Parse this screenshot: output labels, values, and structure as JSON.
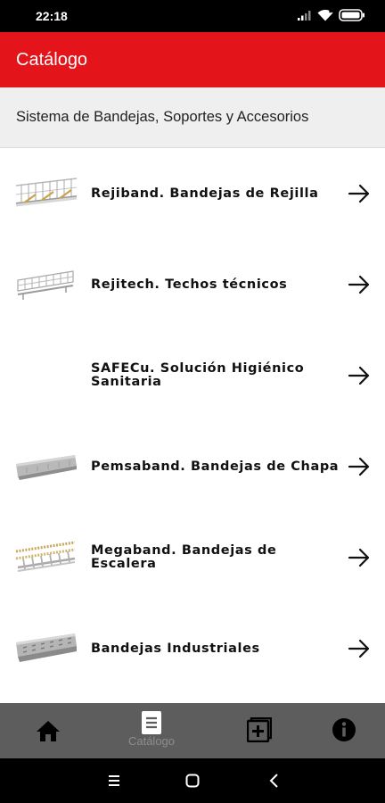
{
  "status_bar": {
    "time": "22:18",
    "icons": [
      "signal-icon",
      "wifi-icon",
      "battery-icon"
    ]
  },
  "app_bar": {
    "title": "Catálogo"
  },
  "section": {
    "title": "Sistema de Bandejas, Soportes y Accesorios"
  },
  "catalog": {
    "items": [
      {
        "label": "Rejiband. Bandejas de Rejilla",
        "thumb": "wire-mesh-tray-image"
      },
      {
        "label": "Rejitech. Techos técnicos",
        "thumb": "technical-ceiling-image"
      },
      {
        "label": "SAFECu. Solución Higiénico\nSanitaria",
        "thumb": ""
      },
      {
        "label": "Pemsaband. Bandejas de Chapa",
        "thumb": "sheet-metal-tray-image"
      },
      {
        "label": "Megaband. Bandejas de\nEscalera",
        "thumb": "ladder-tray-image"
      },
      {
        "label": "Bandejas Industriales",
        "thumb": "industrial-tray-image"
      }
    ]
  },
  "bottom_nav": {
    "items": [
      {
        "icon": "home-icon",
        "label": ""
      },
      {
        "icon": "document-icon",
        "label": "Catálogo"
      },
      {
        "icon": "add-box-icon",
        "label": ""
      },
      {
        "icon": "info-icon",
        "label": ""
      }
    ]
  },
  "system_nav": {
    "buttons": [
      "menu-icon",
      "home-circle-icon",
      "back-icon"
    ]
  },
  "colors": {
    "primary": "#e4141b",
    "nav_background": "#5d5d5d",
    "section_background": "#efefef",
    "inactive_label": "#8d8d8d"
  }
}
